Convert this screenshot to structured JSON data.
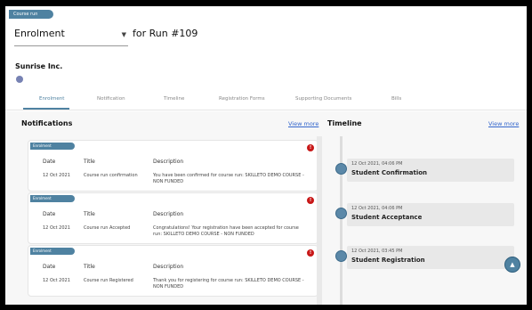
{
  "header": {
    "tag": "Course run",
    "select_value": "Enrolment",
    "for_run": "for Run #109",
    "company": "Sunrise Inc."
  },
  "tabs": [
    "Enrolment",
    "Notification",
    "Timeline",
    "Registration Forms",
    "Supporting Documents",
    "Bills"
  ],
  "notifications": {
    "title": "Notifications",
    "view_more": "View more",
    "columns": [
      "Date",
      "Title",
      "Description"
    ],
    "cards": [
      {
        "badge": "Enrolment",
        "date": "12 Oct 2021",
        "title": "Course run confirmation",
        "description": "You have been confirmed for course run: SKILLETO DEMO COURSE - NON FUNDED"
      },
      {
        "badge": "Enrolment",
        "date": "12 Oct 2021",
        "title": "Course run Accepted",
        "description": "Congratulations! Your registration have been accepted for course run: SKILLETO DEMO COURSE - NON FUNDED"
      },
      {
        "badge": "Enrolment",
        "date": "12 Oct 2021",
        "title": "Course run Registered",
        "description": "Thank you for registering for course run: SKILLETO DEMO COURSE - NON FUNDED"
      }
    ]
  },
  "timeline": {
    "title": "Timeline",
    "view_more": "View more",
    "items": [
      {
        "time": "12 Oct 2021, 04:06 PM",
        "event": "Student Confirmation"
      },
      {
        "time": "12 Oct 2021, 04:06 PM",
        "event": "Student Acceptance"
      },
      {
        "time": "12 Oct 2021, 03:45 PM",
        "event": "Student Registration"
      }
    ]
  },
  "colors": {
    "accent": "#4f82a1",
    "alert": "#c81818",
    "link": "#3366cc"
  },
  "icons": {
    "dropdown": "chevron-down-icon",
    "company": "company-badge-icon",
    "alert": "alert-icon",
    "fab": "chevron-up-icon"
  }
}
